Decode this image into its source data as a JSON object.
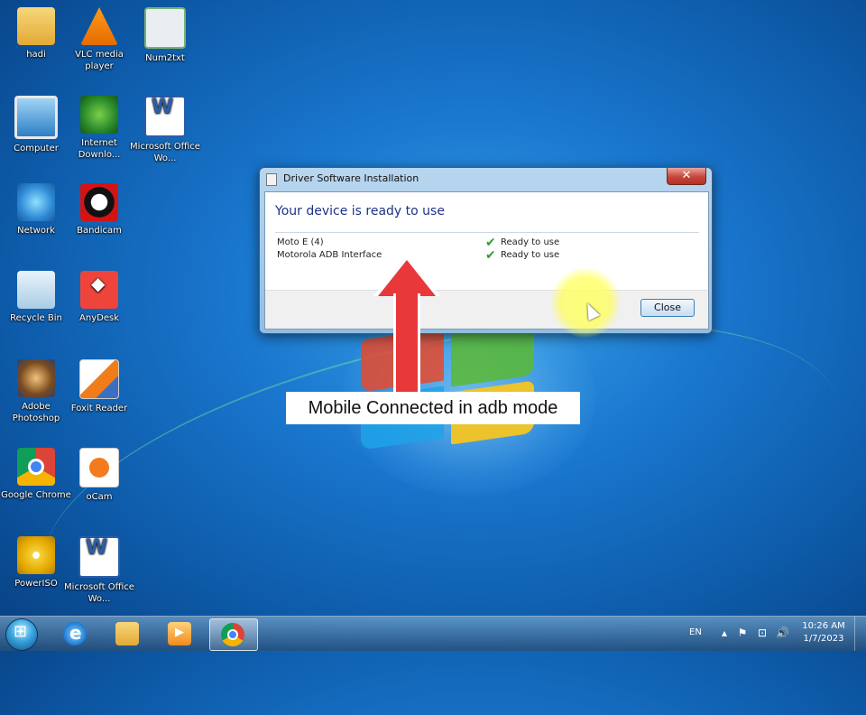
{
  "desktop": {
    "icons": [
      {
        "label": "hadi",
        "icon": "user-folder-icon"
      },
      {
        "label": "VLC media player",
        "icon": "vlc-icon"
      },
      {
        "label": "Num2txt",
        "icon": "spreadsheet-icon"
      },
      {
        "label": "Computer",
        "icon": "computer-icon"
      },
      {
        "label": "Internet Downlo...",
        "icon": "internet-download-manager-icon"
      },
      {
        "label": "Microsoft Office Wo...",
        "icon": "word-icon"
      },
      {
        "label": "Network",
        "icon": "network-icon"
      },
      {
        "label": "Bandicam",
        "icon": "bandicam-icon"
      },
      {
        "label": "Recycle Bin",
        "icon": "recycle-bin-icon"
      },
      {
        "label": "AnyDesk",
        "icon": "anydesk-icon"
      },
      {
        "label": "Adobe Photoshop",
        "icon": "photoshop-icon"
      },
      {
        "label": "Foxit Reader",
        "icon": "foxit-reader-icon"
      },
      {
        "label": "Google Chrome",
        "icon": "chrome-icon"
      },
      {
        "label": "oCam",
        "icon": "ocam-icon"
      },
      {
        "label": "PowerISO",
        "icon": "poweriso-icon"
      },
      {
        "label": "Microsoft Office Wo...",
        "icon": "word-icon"
      }
    ]
  },
  "dialog": {
    "title": "Driver Software Installation",
    "close_glyph": "✕",
    "heading": "Your device is ready to use",
    "devices": [
      {
        "name": "Moto E (4)",
        "status": "Ready to use"
      },
      {
        "name": "Motorola ADB Interface",
        "status": "Ready to use"
      }
    ],
    "close_button": "Close"
  },
  "annotation": {
    "caption": "Mobile Connected in adb mode",
    "arrow_color": "#e8383a",
    "highlight_color": "#ffff66"
  },
  "taskbar": {
    "pinned": [
      "start-orb",
      "internet-explorer-icon",
      "file-explorer-icon",
      "media-player-icon",
      "chrome-icon"
    ],
    "language": "EN",
    "time": "10:26 AM",
    "date": "1/7/2023"
  }
}
